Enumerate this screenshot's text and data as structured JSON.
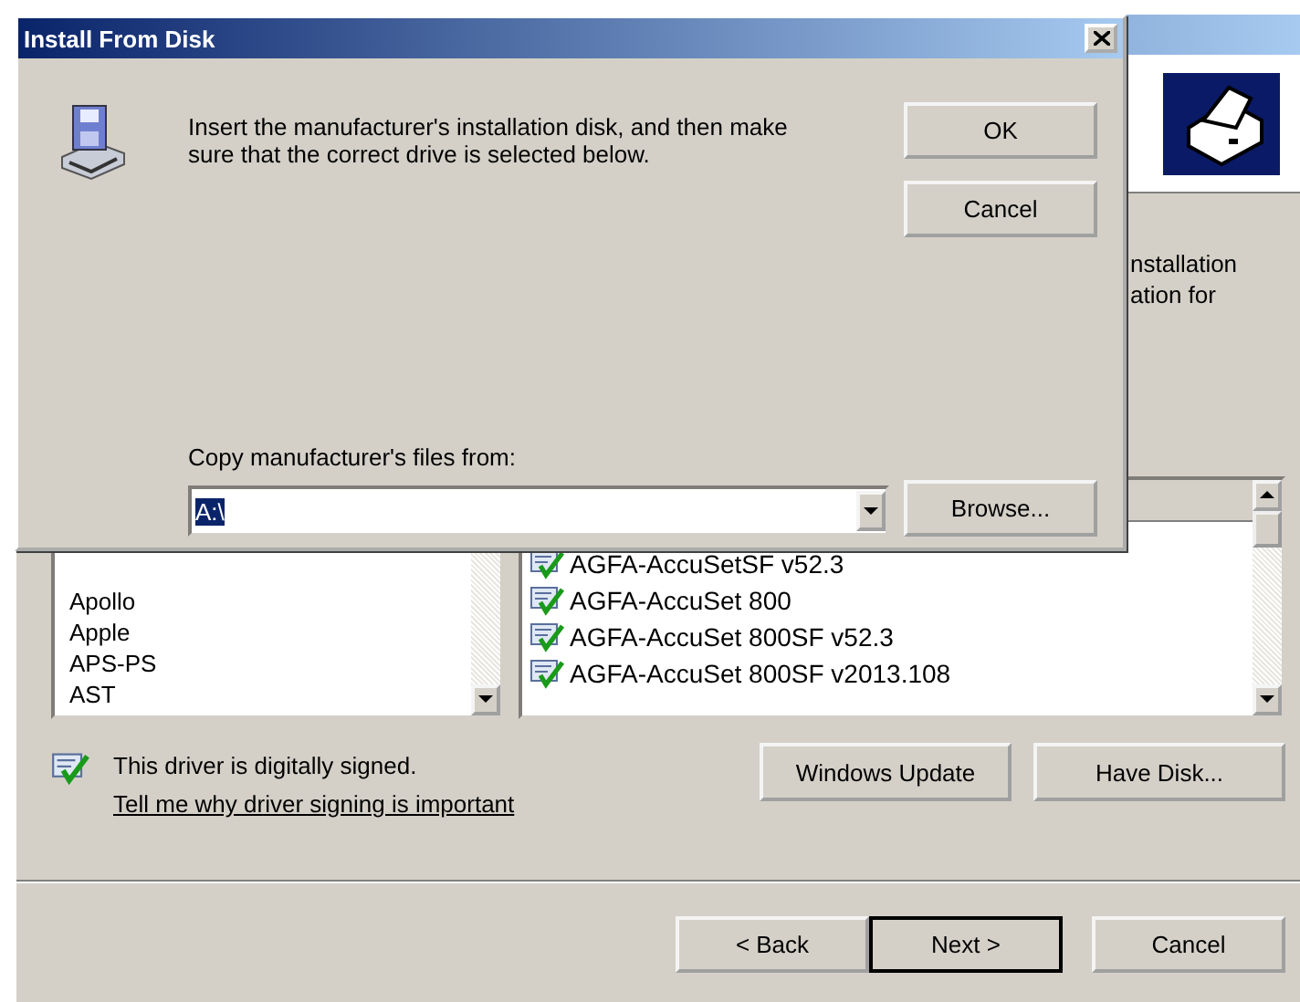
{
  "wizard": {
    "header_text": [
      "nstallation",
      "ation for"
    ],
    "manufacturers": [
      "Apollo",
      "Apple",
      "APS-PS",
      "AST"
    ],
    "models": [
      "AGFA-AccuSetSF v52.3",
      "AGFA-AccuSet 800",
      "AGFA-AccuSet 800SF v52.3",
      "AGFA-AccuSet 800SF v2013.108"
    ],
    "signed_text": "This driver is digitally signed.",
    "signing_link": "Tell me why driver signing is important",
    "buttons": [
      "Windows Update",
      "Have Disk..."
    ],
    "nav_buttons": [
      {
        "label": "< Back",
        "default": false
      },
      {
        "label": "Next >",
        "default": true
      },
      {
        "label": "Cancel",
        "default": false
      }
    ]
  },
  "dialog": {
    "title": "Install From Disk",
    "message": "Insert the manufacturer's installation disk, and then make sure that the correct drive is selected below.",
    "buttons": [
      "OK",
      "Cancel"
    ],
    "copy_label": "Copy manufacturer's files from:",
    "path": {
      "value": "A:\\",
      "selected": true
    },
    "browse": "Browse..."
  }
}
